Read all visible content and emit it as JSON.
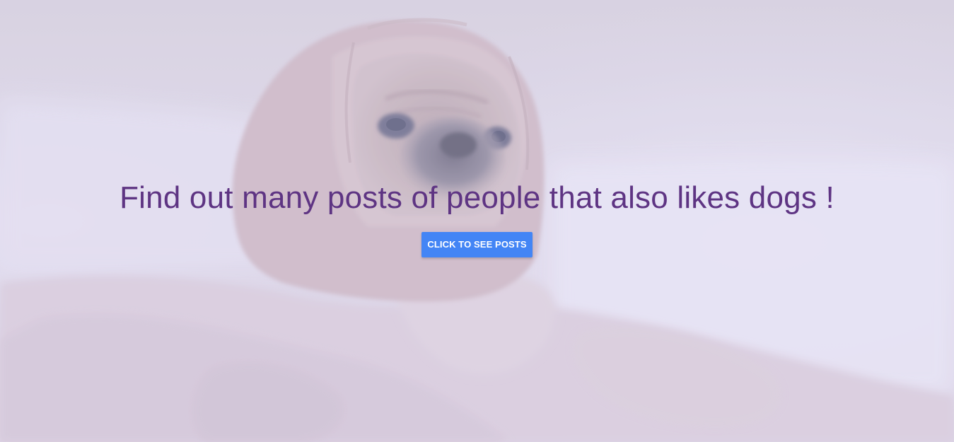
{
  "hero": {
    "title": "Find out many posts of people that also likes dogs !",
    "button_label": "CLICK TO SEE POSTS",
    "image_subject": "pug wrapped in blanket",
    "title_color": "#5e3483",
    "button_color": "#4385f5"
  }
}
